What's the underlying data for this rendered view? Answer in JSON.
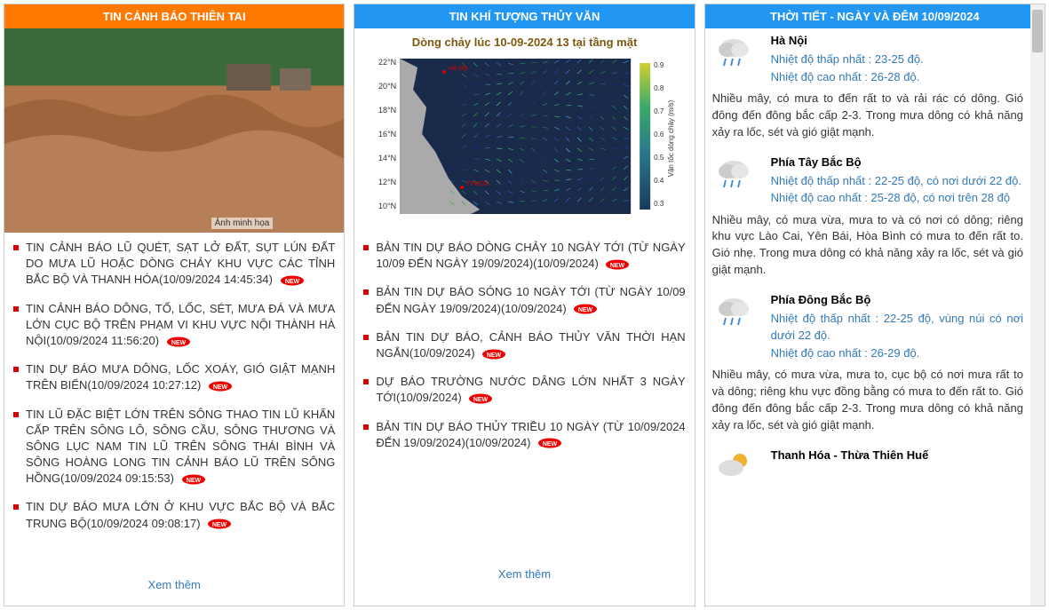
{
  "panels": [
    {
      "title": "TIN CẢNH BÁO THIÊN TAI",
      "image_caption": "Ảnh minh họa",
      "items": [
        {
          "text": "TIN CẢNH BÁO LŨ QUÉT, SẠT LỞ ĐẤT, SỤT LÚN ĐẤT DO MƯA LŨ HOẶC DÒNG CHẢY KHU VỰC CÁC TỈNH BẮC BỘ VÀ THANH HÓA",
          "ts": "(10/09/2024 14:45:34)",
          "new": true
        },
        {
          "text": "TIN CẢNH BÁO DÔNG, TỐ, LỐC, SÉT, MƯA ĐÁ VÀ MƯA LỚN CỤC BỘ TRÊN PHẠM VI KHU VỰC NỘI THÀNH HÀ NỘI",
          "ts": "(10/09/2024 11:56:20)",
          "new": true
        },
        {
          "text": "TIN DỰ BÁO MƯA DÔNG, LỐC XOÁY, GIÓ GIẬT MẠNH TRÊN BIỂN",
          "ts": "(10/09/2024 10:27:12)",
          "new": true
        },
        {
          "text": "TIN LŨ ĐẶC BIỆT LỚN TRÊN SÔNG THAO TIN LŨ KHẨN CẤP TRÊN SÔNG LÔ, SÔNG CẦU, SÔNG THƯƠNG VÀ SÔNG LỤC NAM TIN LŨ TRÊN SÔNG THÁI BÌNH VÀ SÔNG HOÀNG LONG TIN CẢNH BÁO LŨ TRÊN SÔNG HỒNG",
          "ts": "(10/09/2024 09:15:53)",
          "new": true
        },
        {
          "text": "TIN DỰ BÁO MƯA LỚN Ở KHU VỰC BẮC BỘ VÀ BẮC TRUNG BỘ",
          "ts": "(10/09/2024 09:08:17)",
          "new": true
        }
      ],
      "more": "Xem thêm"
    },
    {
      "title": "TIN KHÍ TƯỢNG THỦY VĂN",
      "chart_title": "Dòng chảy lúc 10-09-2024 13 tại tầng mặt",
      "items": [
        {
          "text": "BẢN TIN DỰ BÁO DÒNG CHẢY 10 NGÀY TỚI (TỪ NGÀY 10/09 ĐẾN NGÀY 19/09/2024)",
          "ts": "(10/09/2024)",
          "new": true
        },
        {
          "text": "BẢN TIN DỰ BÁO SÓNG 10 NGÀY TỚI (TỪ NGÀY 10/09 ĐẾN NGÀY 19/09/2024)",
          "ts": "(10/09/2024)",
          "new": true
        },
        {
          "text": "BẢN TIN DỰ BÁO, CẢNH BÁO THỦY VĂN THỜI HẠN NGẮN",
          "ts": "(10/09/2024)",
          "new": true
        },
        {
          "text": "DỰ BÁO TRƯỜNG NƯỚC DÂNG LỚN NHẤT 3 NGÀY TỚI",
          "ts": "(10/09/2024)",
          "new": true
        },
        {
          "text": "BẢN TIN DỰ BÁO THỦY TRIỀU 10 NGÀY (TỪ 10/09/2024 ĐẾN 19/09/2024)",
          "ts": "(10/09/2024)",
          "new": true
        }
      ],
      "more": "Xem thêm"
    },
    {
      "title": "THỜI TIẾT - NGÀY VÀ ĐÊM 10/09/2024",
      "forecasts": [
        {
          "region": "Hà Nội",
          "low": "Nhiệt độ thấp nhất : 23-25 độ.",
          "high": "Nhiệt độ cao nhất : 26-28 độ.",
          "desc": "Nhiều mây, có mưa to đến rất to và rải rác có dông. Gió đông đến đông bắc cấp 2-3. Trong mưa dông có khả năng xảy ra lốc, sét và gió giật mạnh."
        },
        {
          "region": "Phía Tây Bắc Bộ",
          "low": "Nhiệt độ thấp nhất : 22-25 độ, có nơi dưới 22 độ.",
          "high": "Nhiệt độ cao nhất : 25-28 độ, có nơi trên 28 độ",
          "desc": "Nhiều mây, có mưa vừa, mưa to và có nơi có dông; riêng khu vực Lào Cai, Yên Bái, Hòa Bình có mưa to đến rất to. Gió nhẹ. Trong mưa dông có khả năng xảy ra lốc, sét và gió giật mạnh."
        },
        {
          "region": "Phía Đông Bắc Bộ",
          "low": "Nhiệt độ thấp nhất : 22-25 độ, vùng núi có nơi dưới 22 độ.",
          "high": "Nhiệt độ cao nhất : 26-29 độ.",
          "desc": "Nhiều mây, có mưa vừa, mưa to, cục bộ có nơi mưa rất to và dông; riêng khu vực đồng bằng có mưa to đến rất to. Gió đông đến đông bắc cấp 2-3. Trong mưa dông có khả năng xảy ra lốc, sét và gió giật mạnh."
        },
        {
          "region": "Thanh Hóa - Thừa Thiên Huế",
          "low": "",
          "high": "",
          "desc": ""
        }
      ]
    }
  ],
  "new_label": "NEW",
  "chart_data": {
    "type": "heatmap",
    "title": "Dòng chảy lúc 10-09-2024 13 tại tầng mặt",
    "y_ticks": [
      "22°N",
      "20°N",
      "18°N",
      "16°N",
      "14°N",
      "12°N",
      "10°N"
    ],
    "colorbar_ticks": [
      "0.9",
      "0.8",
      "0.7",
      "0.6",
      "0.5",
      "0.4",
      "0.3"
    ],
    "colorbar_label": "Vận tốc dòng chảy (m/s)",
    "markers": [
      "Hà Nội",
      "TPHCM"
    ],
    "note": "Vector field over sea, land masked grey; values range ~0.3–0.9 m/s"
  }
}
